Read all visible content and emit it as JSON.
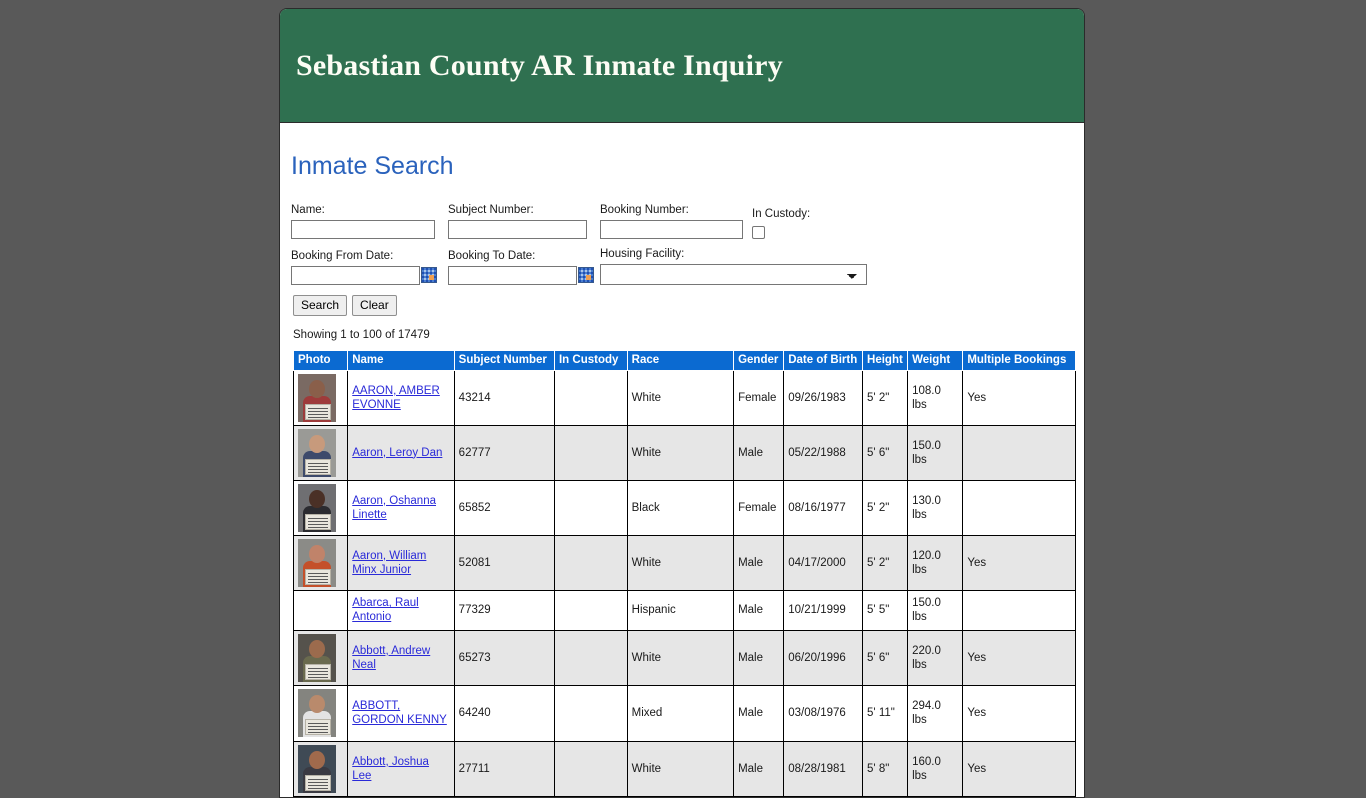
{
  "site": {
    "title": "Sebastian County AR Inmate Inquiry",
    "header_color": "#2f7050",
    "accent_link_color": "#2a62bc",
    "table_header_color": "#0b6ad1"
  },
  "page": {
    "heading": "Inmate Search"
  },
  "search_form": {
    "name": {
      "label": "Name:",
      "value": "",
      "placeholder": ""
    },
    "subject_number": {
      "label": "Subject Number:",
      "value": "",
      "placeholder": ""
    },
    "booking_number": {
      "label": "Booking Number:",
      "value": "",
      "placeholder": ""
    },
    "in_custody": {
      "label": "In Custody:",
      "checked": false
    },
    "booking_from_date": {
      "label": "Booking From Date:",
      "value": "",
      "placeholder": "",
      "icon": "calendar-icon"
    },
    "booking_to_date": {
      "label": "Booking To Date:",
      "value": "",
      "placeholder": "",
      "icon": "calendar-icon"
    },
    "housing_facility": {
      "label": "Housing Facility:",
      "selected": "",
      "options": [
        ""
      ]
    },
    "search_button": "Search",
    "clear_button": "Clear"
  },
  "results": {
    "showing": "Showing 1 to 100 of 17479",
    "columns": [
      "Photo",
      "Name",
      "Subject Number",
      "In Custody",
      "Race",
      "Gender",
      "Date of Birth",
      "Height",
      "Weight",
      "Multiple Bookings"
    ],
    "rows": [
      {
        "photo": "mugshot",
        "photo_colors": {
          "bg": "#7a6a63",
          "skin": "#8a5f4a",
          "shirt": "#9e3b3b"
        },
        "name": "AARON, AMBER EVONNE",
        "subject_number": "43214",
        "in_custody": "",
        "race": "White",
        "gender": "Female",
        "date_of_birth": "09/26/1983",
        "height": "5' 2\"",
        "weight": "108.0 lbs",
        "multiple_bookings": "Yes"
      },
      {
        "photo": "mugshot",
        "photo_colors": {
          "bg": "#9a9a96",
          "skin": "#c79a7c",
          "shirt": "#3d4a6b"
        },
        "name": "Aaron, Leroy Dan",
        "subject_number": "62777",
        "in_custody": "",
        "race": "White",
        "gender": "Male",
        "date_of_birth": "05/22/1988",
        "height": "5' 6\"",
        "weight": "150.0 lbs",
        "multiple_bookings": ""
      },
      {
        "photo": "mugshot",
        "photo_colors": {
          "bg": "#6f6f72",
          "skin": "#4a3026",
          "shirt": "#2b2b30"
        },
        "name": "Aaron, Oshanna Linette",
        "subject_number": "65852",
        "in_custody": "",
        "race": "Black",
        "gender": "Female",
        "date_of_birth": "08/16/1977",
        "height": "5' 2\"",
        "weight": "130.0 lbs",
        "multiple_bookings": ""
      },
      {
        "photo": "mugshot",
        "photo_colors": {
          "bg": "#8b8b87",
          "skin": "#c0836a",
          "shirt": "#c4502a"
        },
        "name": "Aaron, William Minx Junior",
        "subject_number": "52081",
        "in_custody": "",
        "race": "White",
        "gender": "Male",
        "date_of_birth": "04/17/2000",
        "height": "5' 2\"",
        "weight": "120.0 lbs",
        "multiple_bookings": "Yes"
      },
      {
        "photo": "none",
        "photo_colors": null,
        "name": "Abarca, Raul Antonio",
        "subject_number": "77329",
        "in_custody": "",
        "race": "Hispanic",
        "gender": "Male",
        "date_of_birth": "10/21/1999",
        "height": "5' 5\"",
        "weight": "150.0 lbs",
        "multiple_bookings": ""
      },
      {
        "photo": "mugshot",
        "photo_colors": {
          "bg": "#55524c",
          "skin": "#9c6b4d",
          "shirt": "#6a6a4e"
        },
        "name": "Abbott, Andrew Neal",
        "subject_number": "65273",
        "in_custody": "",
        "race": "White",
        "gender": "Male",
        "date_of_birth": "06/20/1996",
        "height": "5' 6\"",
        "weight": "220.0 lbs",
        "multiple_bookings": "Yes"
      },
      {
        "photo": "mugshot",
        "photo_colors": {
          "bg": "#84847f",
          "skin": "#b98a6c",
          "shirt": "#e3e3e3"
        },
        "name": "ABBOTT, GORDON KENNY",
        "subject_number": "64240",
        "in_custody": "",
        "race": "Mixed",
        "gender": "Male",
        "date_of_birth": "03/08/1976",
        "height": "5' 11\"",
        "weight": "294.0 lbs",
        "multiple_bookings": "Yes"
      },
      {
        "photo": "mugshot",
        "photo_colors": {
          "bg": "#3f4a55",
          "skin": "#a06a4c",
          "shirt": "#3a3a42"
        },
        "name": "Abbott, Joshua Lee",
        "subject_number": "27711",
        "in_custody": "",
        "race": "White",
        "gender": "Male",
        "date_of_birth": "08/28/1981",
        "height": "5' 8\"",
        "weight": "160.0 lbs",
        "multiple_bookings": "Yes"
      }
    ]
  }
}
